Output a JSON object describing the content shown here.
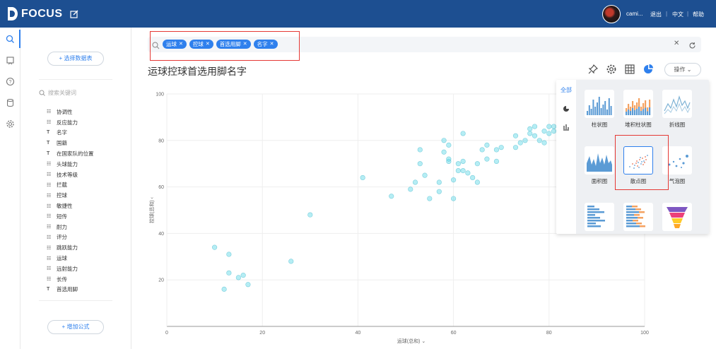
{
  "app": {
    "logo_text": "FOCUS",
    "user_name": "cami...",
    "logout_label": "退出",
    "lang_label": "中文",
    "help_label": "帮助"
  },
  "panel": {
    "select_table_label": "+ 选择数据表",
    "search_placeholder": "搜索关键词",
    "fields": [
      {
        "type": "measure",
        "name": "协调性"
      },
      {
        "type": "measure",
        "name": "反应能力"
      },
      {
        "type": "text",
        "name": "名字"
      },
      {
        "type": "text",
        "name": "国籍"
      },
      {
        "type": "text",
        "name": "在国家队的位置"
      },
      {
        "type": "measure",
        "name": "头球能力"
      },
      {
        "type": "measure",
        "name": "技术等级"
      },
      {
        "type": "measure",
        "name": "拦截"
      },
      {
        "type": "measure",
        "name": "控球"
      },
      {
        "type": "measure",
        "name": "敏捷性"
      },
      {
        "type": "measure",
        "name": "短传"
      },
      {
        "type": "measure",
        "name": "耐力"
      },
      {
        "type": "measure",
        "name": "评分"
      },
      {
        "type": "measure",
        "name": "跳跃能力"
      },
      {
        "type": "measure",
        "name": "运球"
      },
      {
        "type": "measure",
        "name": "远射能力"
      },
      {
        "type": "measure",
        "name": "长传"
      },
      {
        "type": "text",
        "name": "首选用脚"
      }
    ],
    "add_formula_label": "+ 增加公式"
  },
  "search": {
    "tokens": [
      "运球",
      "控球",
      "首选用脚",
      "名字"
    ]
  },
  "page_title": "运球控球首选用脚名字",
  "toolbar": {
    "operate_label": "操作"
  },
  "chart_popup": {
    "tab_all": "全部",
    "types": [
      "柱状图",
      "堆积柱状图",
      "折线图",
      "面积图",
      "散点图",
      "气泡图"
    ]
  },
  "chart_data": {
    "type": "scatter",
    "xlabel": "运球(总和)",
    "ylabel": "控球(总和)",
    "xlim": [
      0,
      100
    ],
    "ylim": [
      0,
      100
    ],
    "x_ticks": [
      0,
      20,
      40,
      60,
      80,
      100
    ],
    "y_ticks": [
      20,
      40,
      60,
      80,
      100
    ],
    "grid": true,
    "color": "#5ad8e6",
    "points": [
      [
        10,
        34
      ],
      [
        13,
        31
      ],
      [
        13,
        23
      ],
      [
        15,
        21
      ],
      [
        16,
        22
      ],
      [
        17,
        18
      ],
      [
        12,
        16
      ],
      [
        26,
        28
      ],
      [
        30,
        48
      ],
      [
        41,
        64
      ],
      [
        47,
        56
      ],
      [
        51,
        59
      ],
      [
        52,
        62
      ],
      [
        55,
        55
      ],
      [
        53,
        70
      ],
      [
        53,
        76
      ],
      [
        54,
        65
      ],
      [
        57,
        62
      ],
      [
        57,
        58
      ],
      [
        58,
        75
      ],
      [
        58,
        80
      ],
      [
        59,
        71
      ],
      [
        59,
        78
      ],
      [
        60,
        63
      ],
      [
        61,
        70
      ],
      [
        61,
        67
      ],
      [
        62,
        71
      ],
      [
        62,
        83
      ],
      [
        62,
        67
      ],
      [
        63,
        66
      ],
      [
        64,
        64
      ],
      [
        65,
        62
      ],
      [
        65,
        70
      ],
      [
        66,
        76
      ],
      [
        67,
        78
      ],
      [
        67,
        72
      ],
      [
        69,
        76
      ],
      [
        69,
        71
      ],
      [
        70,
        77
      ],
      [
        73,
        77
      ],
      [
        73,
        82
      ],
      [
        74,
        79
      ],
      [
        75,
        80
      ],
      [
        76,
        85
      ],
      [
        76,
        83
      ],
      [
        77,
        82
      ],
      [
        77,
        86
      ],
      [
        78,
        80
      ],
      [
        79,
        79
      ],
      [
        79,
        84
      ],
      [
        80,
        83
      ],
      [
        80,
        86
      ],
      [
        81,
        84
      ],
      [
        81,
        86
      ],
      [
        60,
        55
      ],
      [
        59,
        72
      ]
    ]
  }
}
